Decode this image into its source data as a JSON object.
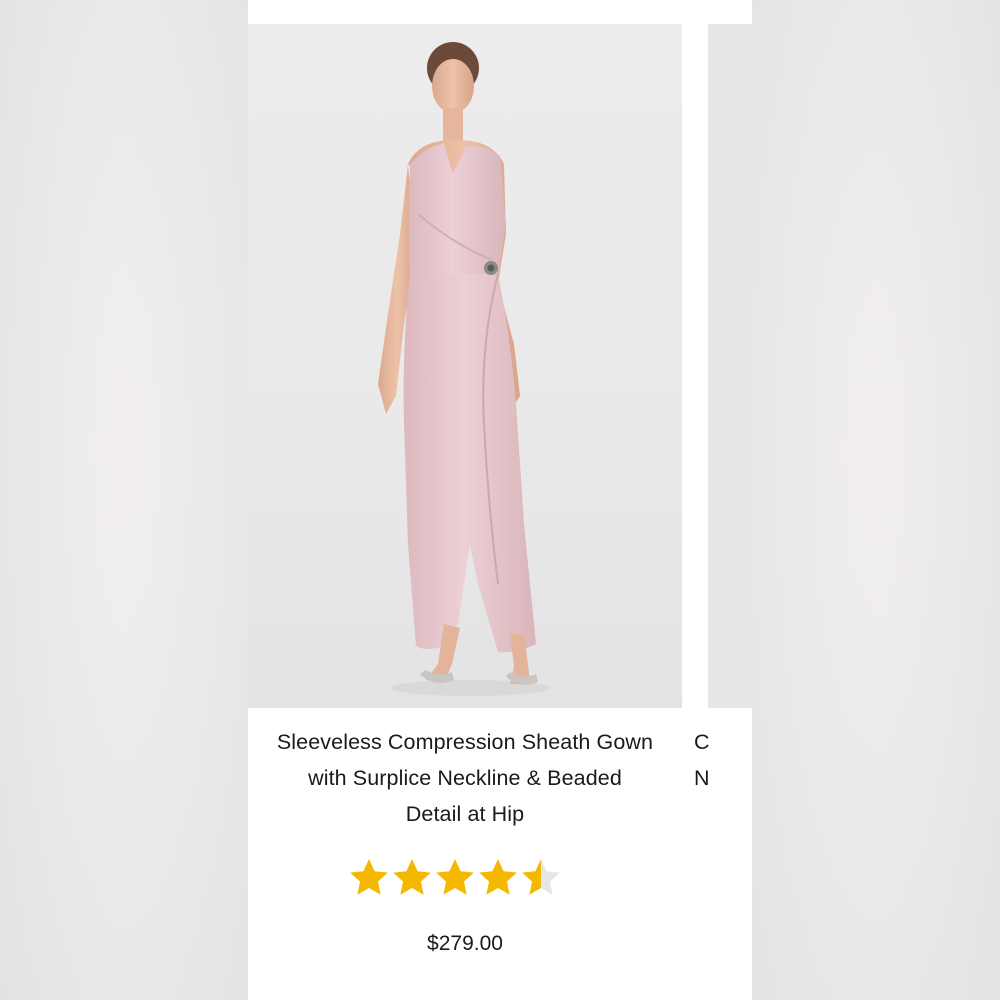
{
  "product": {
    "title_line1": "Sleeveless Compression Sheath Gown",
    "title_line2": "with Surplice Neckline & Beaded",
    "title_line3": "Detail at Hip",
    "rating": 4.5,
    "rating_max": 5,
    "price": "$279.00",
    "image_alt": "Model wearing blush pink sleeveless sheath gown"
  },
  "next_product": {
    "title_line1": "C",
    "title_line2": "N"
  },
  "colors": {
    "star_filled": "#f5b800",
    "star_empty": "#e6e6e6",
    "dress": "#e8c9cf",
    "text": "#1a1a1a"
  },
  "icons": {
    "star": "star-icon"
  }
}
